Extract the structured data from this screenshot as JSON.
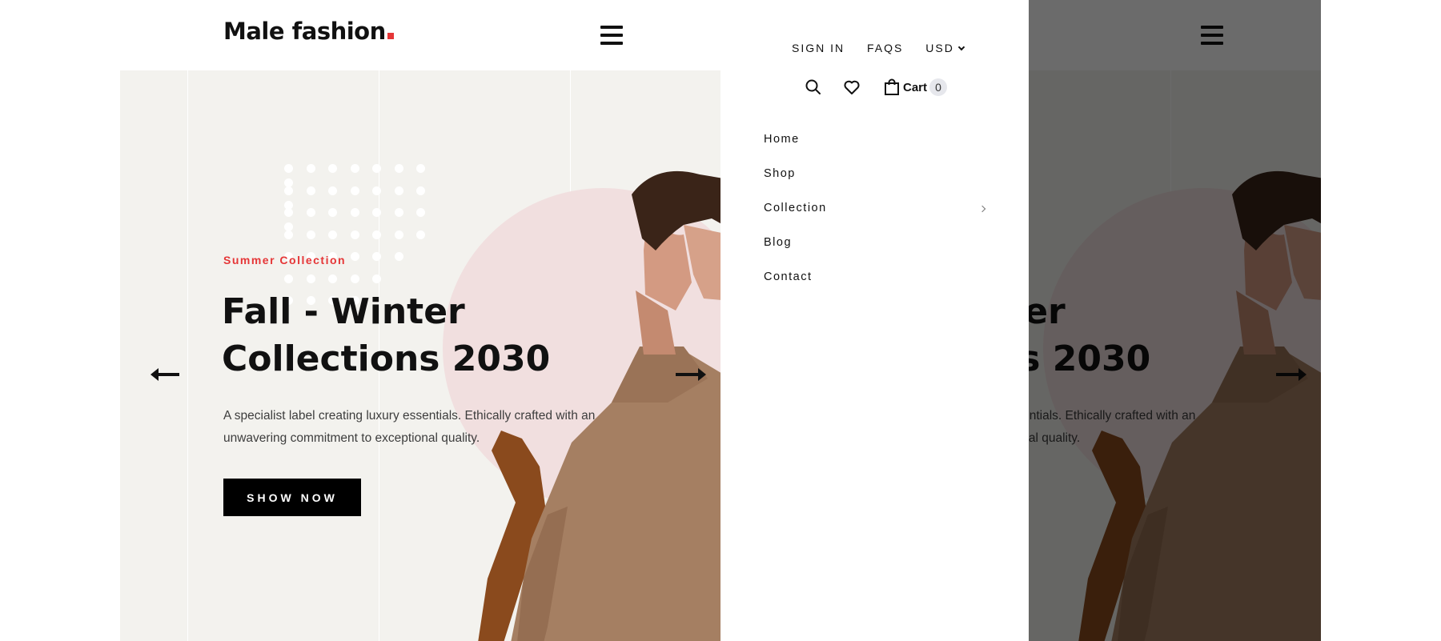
{
  "brand": {
    "logo_text": "Male fashion",
    "accent_color": "#e53637"
  },
  "hero": {
    "subtitle": "Summer Collection",
    "title_line1": "Fall - Winter",
    "title_line2": "Collections 2030",
    "description_line1": "A specialist label creating luxury essentials. Ethically crafted with an",
    "description_line2": "unwavering commitment to exceptional quality.",
    "button_label": "SHOW NOW",
    "background_color": "#f3f2ee",
    "circle_color": "#f1dfdf",
    "prev_icon": "arrow-left-icon",
    "next_icon": "arrow-right-icon"
  },
  "offcanvas": {
    "links": [
      "SIGN IN",
      "FAQS"
    ],
    "currency": "USD",
    "icons": {
      "search": "search-icon",
      "wishlist": "heart-icon",
      "cart": "shopping-bag-icon"
    },
    "cart": {
      "label": "Cart",
      "count": "0"
    },
    "menu": [
      "Home",
      "Shop",
      "Collection",
      "Blog",
      "Contact"
    ]
  }
}
